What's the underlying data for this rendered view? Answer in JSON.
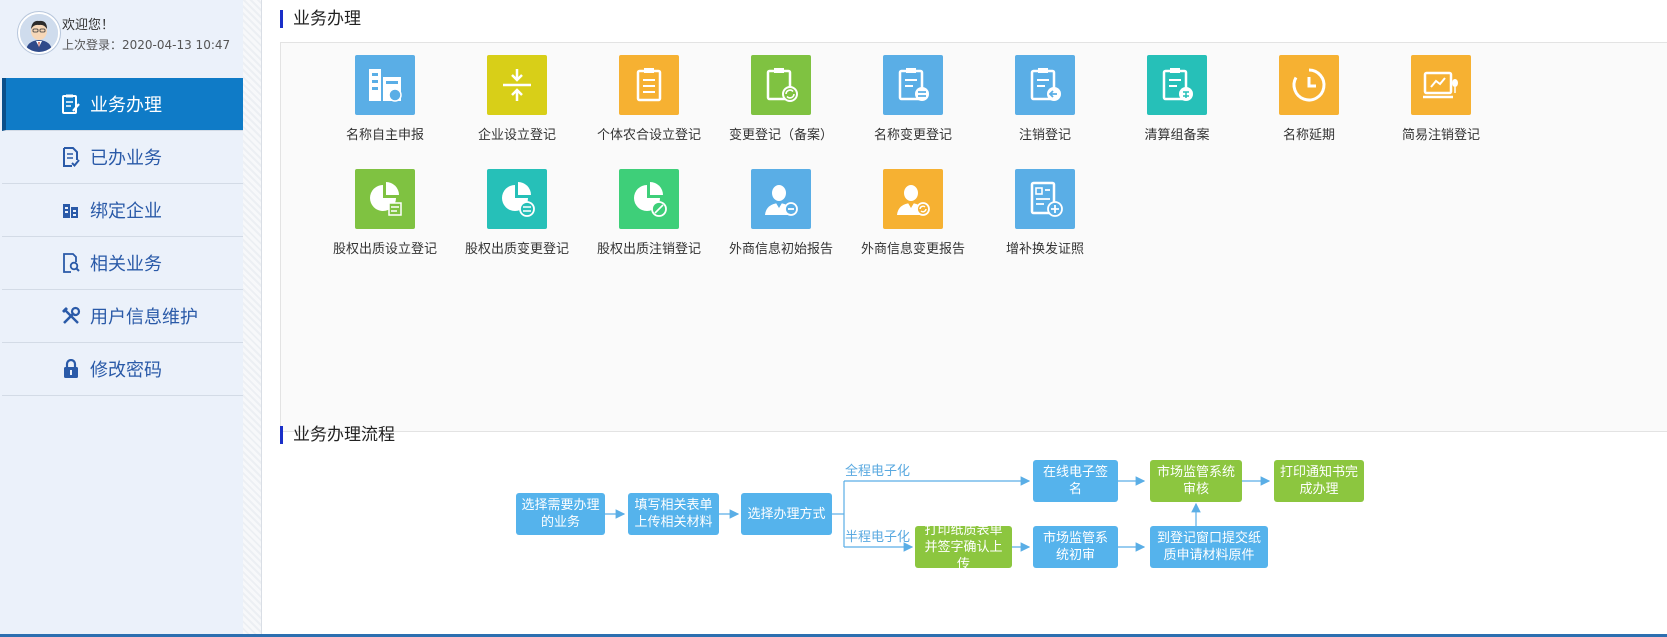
{
  "user": {
    "welcome": "欢迎您！",
    "last_login": "上次登录：2020-04-13 10:47"
  },
  "nav": [
    {
      "label": "业务办理",
      "icon": "clipboard-edit-icon",
      "active": true
    },
    {
      "label": "已办业务",
      "icon": "document-check-icon",
      "active": false
    },
    {
      "label": "绑定企业",
      "icon": "building-icon",
      "active": false
    },
    {
      "label": "相关业务",
      "icon": "document-search-icon",
      "active": false
    },
    {
      "label": "用户信息维护",
      "icon": "tools-icon",
      "active": false
    },
    {
      "label": "修改密码",
      "icon": "lock-icon",
      "active": false
    }
  ],
  "main": {
    "business_title": "业务办理",
    "flow_title": "业务办理流程",
    "tiles": [
      {
        "label": "名称自主申报",
        "icon": "name-declare-icon",
        "color": "#5aaee6"
      },
      {
        "label": "企业设立登记",
        "icon": "enterprise-setup-icon",
        "color": "#d8cf18"
      },
      {
        "label": "个体农合设立登记",
        "icon": "individual-register-icon",
        "color": "#f6b132"
      },
      {
        "label": "变更登记（备案）",
        "icon": "change-register-icon",
        "color": "#7fc241"
      },
      {
        "label": "名称变更登记",
        "icon": "name-change-icon",
        "color": "#5aaee6"
      },
      {
        "label": "注销登记",
        "icon": "cancel-register-icon",
        "color": "#5aaee6"
      },
      {
        "label": "清算组备案",
        "icon": "liquidation-icon",
        "color": "#26c0b8"
      },
      {
        "label": "名称延期",
        "icon": "clock-icon",
        "color": "#f6b132"
      },
      {
        "label": "简易注销登记",
        "icon": "simple-cancel-icon",
        "color": "#f6b132"
      },
      {
        "label": "股权出质设立登记",
        "icon": "pie-edit-icon",
        "color": "#7fc241"
      },
      {
        "label": "股权出质变更登记",
        "icon": "pie-exchange-icon",
        "color": "#26c0b8"
      },
      {
        "label": "股权出质注销登记",
        "icon": "pie-cancel-icon",
        "color": "#3ecf79"
      },
      {
        "label": "外商信息初始报告",
        "icon": "person-report-icon",
        "color": "#5aaee6"
      },
      {
        "label": "外商信息变更报告",
        "icon": "person-change-icon",
        "color": "#f6b132"
      },
      {
        "label": "增补换发证照",
        "icon": "license-add-icon",
        "color": "#5aaee6"
      }
    ]
  },
  "flow": {
    "label_full": "全程电子化",
    "label_half": "半程电子化",
    "step1": "选择需要办理的业务",
    "step2": "填写相关表单上传相关材料",
    "step3": "选择办理方式",
    "full_sign": "在线电子签名",
    "full_review": "市场监管系统审核",
    "full_done": "打印通知书完成办理",
    "half_print": "打印纸质表单并签字确认上传",
    "half_review": "市场监管系统初审",
    "half_submit": "到登记窗口提交纸质申请材料原件"
  }
}
